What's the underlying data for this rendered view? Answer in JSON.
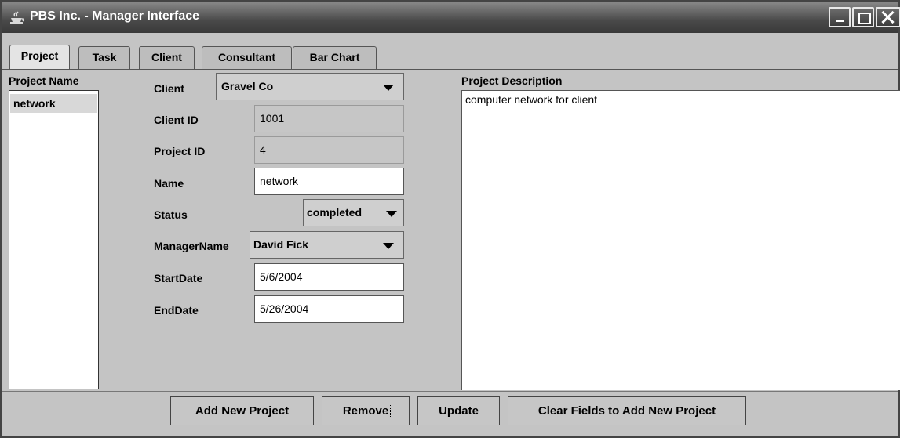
{
  "window": {
    "title": "PBS Inc. - Manager Interface"
  },
  "tabs": [
    {
      "label": "Project",
      "active": true
    },
    {
      "label": "Task",
      "active": false
    },
    {
      "label": "Client",
      "active": false
    },
    {
      "label": "Consultant",
      "active": false
    },
    {
      "label": "Bar Chart",
      "active": false
    }
  ],
  "project_list": {
    "header": "Project Name",
    "items": [
      "network"
    ],
    "selected": "network"
  },
  "form": {
    "client_label": "Client",
    "client_value": "Gravel Co",
    "client_id_label": "Client ID",
    "client_id_value": "1001",
    "project_id_label": "Project ID",
    "project_id_value": "4",
    "name_label": "Name",
    "name_value": "network",
    "status_label": "Status",
    "status_value": "completed",
    "manager_label": "ManagerName",
    "manager_value": "David Fick",
    "start_label": "StartDate",
    "start_value": "5/6/2004",
    "end_label": "EndDate",
    "end_value": "5/26/2004"
  },
  "description": {
    "header": "Project Description",
    "text": "computer network for client"
  },
  "buttons": {
    "add": "Add New Project",
    "remove": "Remove",
    "update": "Update",
    "clear": "Clear Fields to Add New Project"
  },
  "icons": {
    "app": "java-cup-icon",
    "minimize": "minimize-icon",
    "maximize": "maximize-icon",
    "close": "close-icon",
    "dropdown": "chevron-down-icon"
  }
}
